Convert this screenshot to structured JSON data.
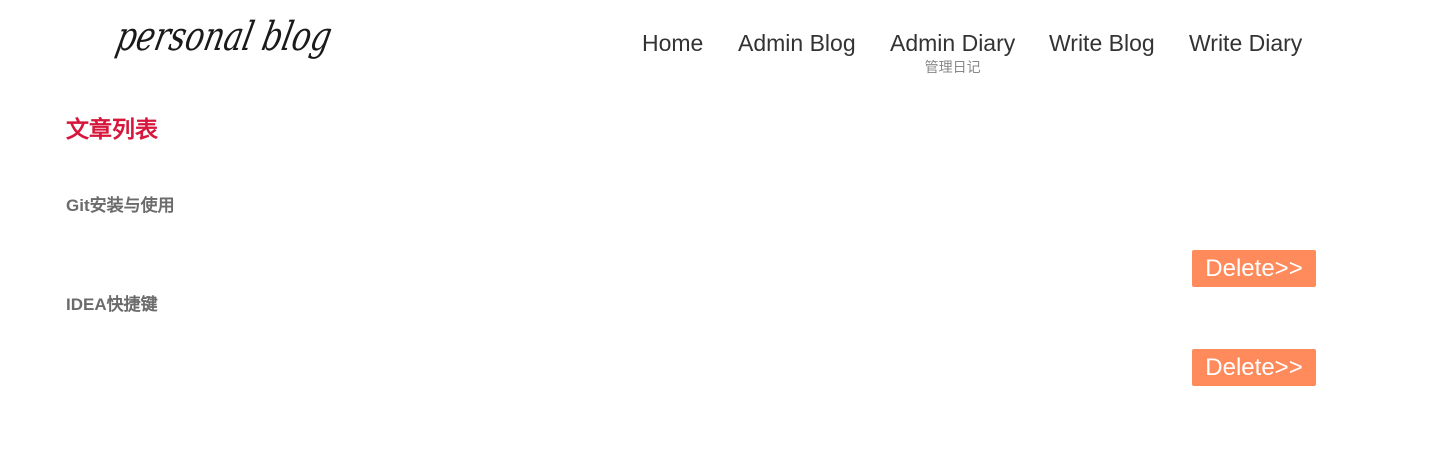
{
  "logo": {
    "text": "personal blog"
  },
  "nav": {
    "items": [
      {
        "label": "Home"
      },
      {
        "label": "Admin Blog"
      },
      {
        "label": "Admin Diary",
        "sublabel": "管理日记"
      },
      {
        "label": "Write Blog"
      },
      {
        "label": "Write Diary"
      }
    ]
  },
  "main": {
    "section_title": "文章列表",
    "articles": [
      {
        "title": "Git安装与使用",
        "action_label": "Delete>>"
      },
      {
        "title": "IDEA快捷键",
        "action_label": "Delete>>"
      }
    ]
  },
  "colors": {
    "title": "#d6163c",
    "delete_button": "#ff8a5b",
    "article_text": "#6b6b6b"
  }
}
